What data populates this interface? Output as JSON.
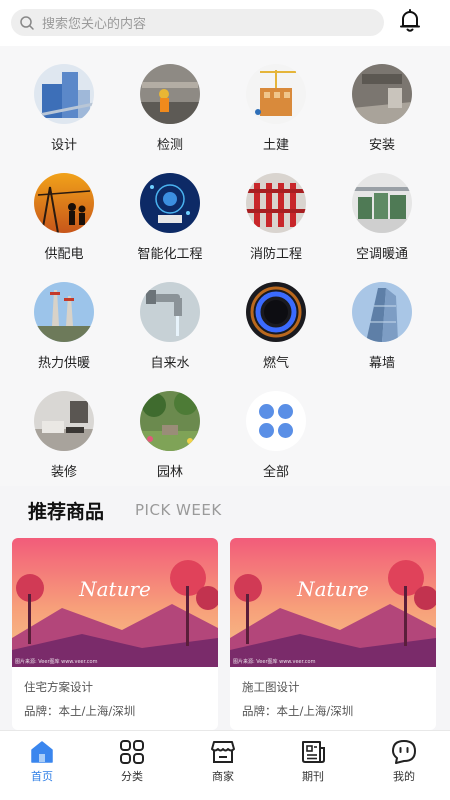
{
  "search": {
    "placeholder": "搜索您关心的内容"
  },
  "categories": [
    {
      "label": "设计"
    },
    {
      "label": "检测"
    },
    {
      "label": "土建"
    },
    {
      "label": "安装"
    },
    {
      "label": "供配电"
    },
    {
      "label": "智能化工程"
    },
    {
      "label": "消防工程"
    },
    {
      "label": "空调暖通"
    },
    {
      "label": "热力供暖"
    },
    {
      "label": "自来水"
    },
    {
      "label": "燃气"
    },
    {
      "label": "幕墙"
    },
    {
      "label": "装修"
    },
    {
      "label": "园林"
    },
    {
      "label": "全部"
    }
  ],
  "recommend": {
    "title": "推荐商品",
    "subtitle": "PICK WEEK"
  },
  "products": [
    {
      "name": "住宅方案设计",
      "brand": "品牌：本土/上海/深圳",
      "image_text": "Nature",
      "credit": "图片来源: Veer图库 www.veer.com"
    },
    {
      "name": "施工图设计",
      "brand": "品牌：本土/上海/深圳",
      "image_text": "Nature",
      "credit": "图片来源: Veer图库 www.veer.com"
    }
  ],
  "nav": [
    {
      "label": "首页",
      "icon": "home-icon"
    },
    {
      "label": "分类",
      "icon": "grid-icon"
    },
    {
      "label": "商家",
      "icon": "store-icon"
    },
    {
      "label": "期刊",
      "icon": "newspaper-icon"
    },
    {
      "label": "我的",
      "icon": "chat-face-icon"
    }
  ],
  "colors": {
    "accent": "#2f7fe6",
    "background": "#f5f5f7"
  }
}
